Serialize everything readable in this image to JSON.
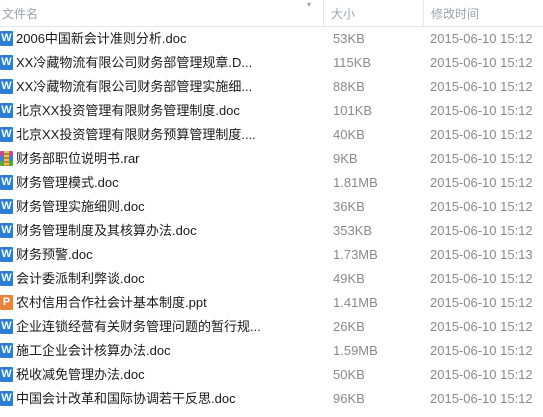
{
  "columns": {
    "name": "文件名",
    "size": "大小",
    "date": "修改时间"
  },
  "files": [
    {
      "icon": "doc-icon",
      "type": "doc",
      "name": "2006中国新会计准则分析.doc",
      "size": "53KB",
      "date": "2015-06-10 15:12"
    },
    {
      "icon": "doc-icon",
      "type": "doc",
      "name": "XX冷藏物流有限公司财务部管理规章.D...",
      "size": "115KB",
      "date": "2015-06-10 15:12"
    },
    {
      "icon": "doc-icon",
      "type": "doc",
      "name": "XX冷藏物流有限公司财务部管理实施细...",
      "size": "88KB",
      "date": "2015-06-10 15:12"
    },
    {
      "icon": "doc-icon",
      "type": "doc",
      "name": "北京XX投资管理有限财务管理制度.doc",
      "size": "101KB",
      "date": "2015-06-10 15:12"
    },
    {
      "icon": "doc-icon",
      "type": "doc",
      "name": "北京XX投资管理有限财务预算管理制度....",
      "size": "40KB",
      "date": "2015-06-10 15:12"
    },
    {
      "icon": "rar-icon",
      "type": "rar",
      "name": "财务部职位说明书.rar",
      "size": "9KB",
      "date": "2015-06-10 15:12"
    },
    {
      "icon": "doc-icon",
      "type": "doc",
      "name": "财务管理模式.doc",
      "size": "1.81MB",
      "date": "2015-06-10 15:12"
    },
    {
      "icon": "doc-icon",
      "type": "doc",
      "name": "财务管理实施细则.doc",
      "size": "36KB",
      "date": "2015-06-10 15:12"
    },
    {
      "icon": "doc-icon",
      "type": "doc",
      "name": "财务管理制度及其核算办法.doc",
      "size": "353KB",
      "date": "2015-06-10 15:12"
    },
    {
      "icon": "doc-icon",
      "type": "doc",
      "name": "财务预警.doc",
      "size": "1.73MB",
      "date": "2015-06-10 15:13"
    },
    {
      "icon": "doc-icon",
      "type": "doc",
      "name": "会计委派制利弊谈.doc",
      "size": "49KB",
      "date": "2015-06-10 15:12"
    },
    {
      "icon": "ppt-icon",
      "type": "ppt",
      "name": "农村信用合作社会计基本制度.ppt",
      "size": "1.41MB",
      "date": "2015-06-10 15:12"
    },
    {
      "icon": "doc-icon",
      "type": "doc",
      "name": "企业连锁经营有关财务管理问题的暂行规...",
      "size": "26KB",
      "date": "2015-06-10 15:12"
    },
    {
      "icon": "doc-icon",
      "type": "doc",
      "name": "施工企业会计核算办法.doc",
      "size": "1.59MB",
      "date": "2015-06-10 15:12"
    },
    {
      "icon": "doc-icon",
      "type": "doc",
      "name": "税收减免管理办法.doc",
      "size": "50KB",
      "date": "2015-06-10 15:12"
    },
    {
      "icon": "doc-icon",
      "type": "doc",
      "name": "中国会计改革和国际协调若干反思.doc",
      "size": "96KB",
      "date": "2015-06-10 15:12"
    }
  ]
}
